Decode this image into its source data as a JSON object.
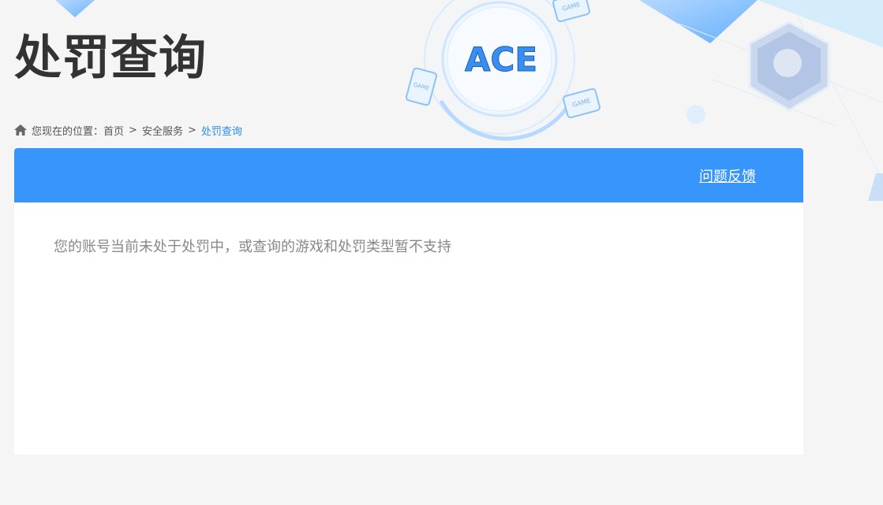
{
  "page": {
    "title": "处罚查询"
  },
  "breadcrumb": {
    "prefix": "您现在的位置：",
    "items": [
      {
        "label": "首页"
      },
      {
        "label": "安全服务"
      },
      {
        "label": "处罚查询"
      }
    ],
    "separator": ">"
  },
  "panel": {
    "feedback_label": "问题反馈",
    "message": "您的账号当前未处于处罚中，或查询的游戏和处罚类型暂不支持"
  },
  "decor": {
    "logo_text": "ACE",
    "game_badge_text": "GAME"
  },
  "colors": {
    "accent": "#3795fc",
    "breadcrumb_current": "#2a8ee8",
    "title": "#333333",
    "message": "#888888"
  }
}
